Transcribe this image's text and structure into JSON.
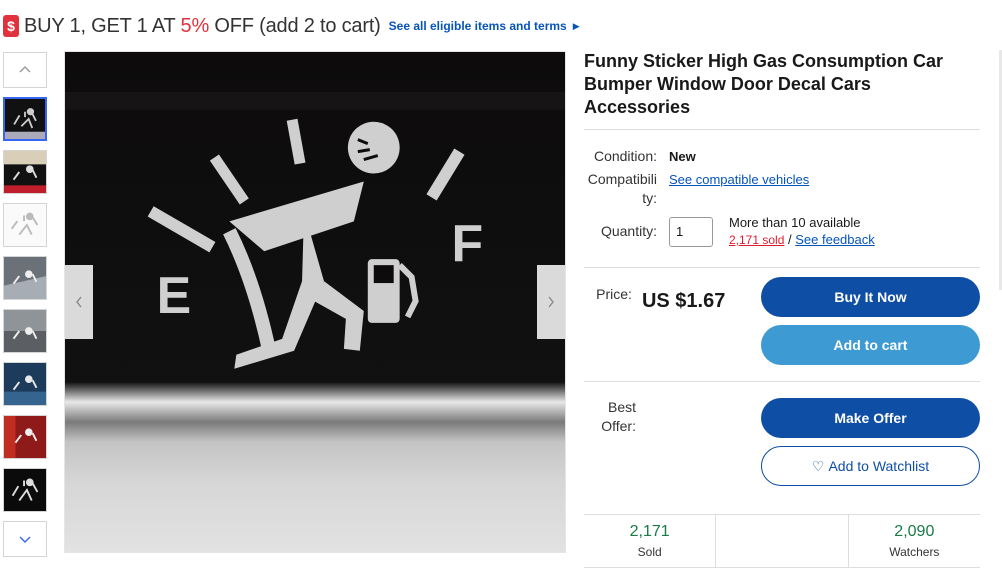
{
  "promo": {
    "icon": "$",
    "title_pre": "BUY 1, GET 1 AT ",
    "title_pct": "5%",
    "title_post": " OFF (add 2 to cart)",
    "link": "See all eligible items and terms"
  },
  "colors": {
    "accent": "#0f4ea5",
    "secondary": "#3d9ad2",
    "promo_red": "#e0323c",
    "sold_green": "#1a7a46"
  },
  "product": {
    "title": "Funny Sticker High Gas Consumption Car Bumper Window Door Decal Cars Accessories",
    "condition_label": "Condition:",
    "condition_value": "New",
    "compat_label": "Compatibility:",
    "compat_link": "See compatible vehicles",
    "quantity_label": "Quantity:",
    "quantity_value": "1",
    "available": "More than 10 available",
    "sold_link": "2,171 sold",
    "separator": " / ",
    "feedback_link": "See feedback",
    "price_label": "Price:",
    "price": "US $1.67",
    "buy_now": "Buy It Now",
    "add_to_cart": "Add to cart",
    "offer_label": "Best Offer:",
    "make_offer": "Make Offer",
    "watchlist": "Add to Watchlist"
  },
  "stats": [
    {
      "value": "2,171",
      "label": "Sold"
    },
    {
      "value": "",
      "label": ""
    },
    {
      "value": "2,090",
      "label": "Watchers"
    }
  ],
  "gallery": {
    "gauge_letter_empty": "E",
    "gauge_letter_full": "F"
  }
}
